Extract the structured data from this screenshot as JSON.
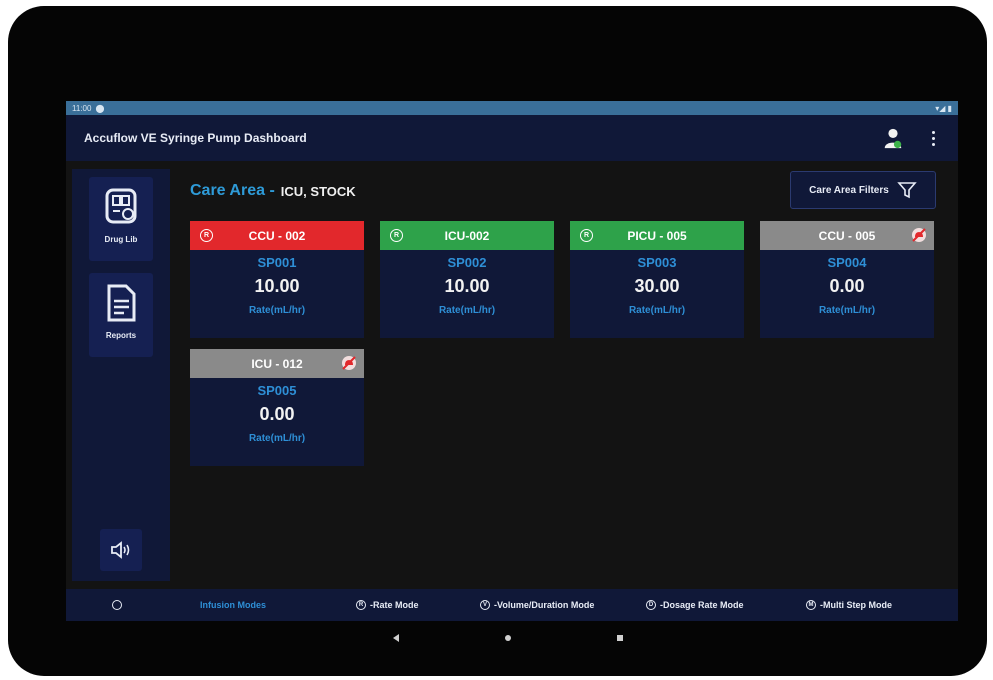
{
  "statusbar": {
    "time": "11:00",
    "signal": "▾◢ ▮"
  },
  "appbar": {
    "title": "Accuflow VE Syringe Pump Dashboard"
  },
  "sidebar": {
    "drug_lib_label": "Drug Lib",
    "reports_label": "Reports"
  },
  "care_area": {
    "label": "Care Area -",
    "value": "ICU, STOCK"
  },
  "filter": {
    "label": "Care Area Filters"
  },
  "cards": [
    {
      "location": "CCU - 002",
      "pump": "SP001",
      "rate": "10.00",
      "rate_label": "Rate(mL/hr)",
      "mode": "R",
      "header_color": "#e2282c",
      "alert": false
    },
    {
      "location": "ICU-002",
      "pump": "SP002",
      "rate": "10.00",
      "rate_label": "Rate(mL/hr)",
      "mode": "R",
      "header_color": "#2ea24a",
      "alert": false
    },
    {
      "location": "PICU - 005",
      "pump": "SP003",
      "rate": "30.00",
      "rate_label": "Rate(mL/hr)",
      "mode": "R",
      "header_color": "#2ea24a",
      "alert": false
    },
    {
      "location": "CCU - 005",
      "pump": "SP004",
      "rate": "0.00",
      "rate_label": "Rate(mL/hr)",
      "mode": "",
      "header_color": "#8a8a8a",
      "alert": true
    },
    {
      "location": "ICU - 012",
      "pump": "SP005",
      "rate": "0.00",
      "rate_label": "Rate(mL/hr)",
      "mode": "",
      "header_color": "#8a8a8a",
      "alert": true
    }
  ],
  "legend": {
    "heading": "Infusion Modes",
    "items": [
      {
        "letter": "R",
        "label": "-Rate Mode"
      },
      {
        "letter": "V",
        "label": "-Volume/Duration Mode"
      },
      {
        "letter": "D",
        "label": "-Dosage Rate Mode"
      },
      {
        "letter": "M",
        "label": "-Multi Step Mode"
      }
    ]
  },
  "colors": {
    "accent_blue": "#2e8fd6",
    "panel": "#101838",
    "running_green": "#2ea24a",
    "alarm_red": "#e2282c",
    "idle_gray": "#8a8a8a"
  },
  "icons": [
    "user-icon",
    "more-vertical-icon",
    "drug-library-icon",
    "reports-icon",
    "speaker-icon",
    "filter-icon",
    "alarm-off-icon",
    "back-icon",
    "home-icon",
    "recents-icon"
  ]
}
